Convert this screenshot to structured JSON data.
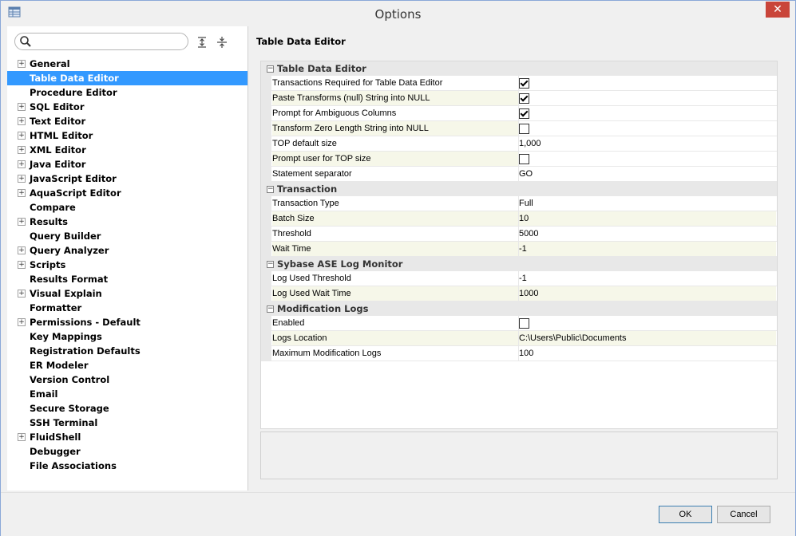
{
  "window": {
    "title": "Options",
    "close_label": "✕"
  },
  "search": {
    "placeholder": "",
    "value": ""
  },
  "tree": [
    {
      "label": "General",
      "expandable": true
    },
    {
      "label": "Table Data Editor",
      "expandable": false,
      "selected": true
    },
    {
      "label": "Procedure Editor",
      "expandable": false
    },
    {
      "label": "SQL Editor",
      "expandable": true
    },
    {
      "label": "Text Editor",
      "expandable": true
    },
    {
      "label": "HTML Editor",
      "expandable": true
    },
    {
      "label": "XML Editor",
      "expandable": true
    },
    {
      "label": "Java Editor",
      "expandable": true
    },
    {
      "label": "JavaScript Editor",
      "expandable": true
    },
    {
      "label": "AquaScript Editor",
      "expandable": true
    },
    {
      "label": "Compare",
      "expandable": false
    },
    {
      "label": "Results",
      "expandable": true
    },
    {
      "label": "Query Builder",
      "expandable": false
    },
    {
      "label": "Query Analyzer",
      "expandable": true
    },
    {
      "label": "Scripts",
      "expandable": true
    },
    {
      "label": "Results Format",
      "expandable": false
    },
    {
      "label": "Visual Explain",
      "expandable": true
    },
    {
      "label": "Formatter",
      "expandable": false
    },
    {
      "label": "Permissions - Default",
      "expandable": true
    },
    {
      "label": "Key Mappings",
      "expandable": false
    },
    {
      "label": "Registration Defaults",
      "expandable": false
    },
    {
      "label": "ER Modeler",
      "expandable": false
    },
    {
      "label": "Version Control",
      "expandable": false
    },
    {
      "label": "Email",
      "expandable": false
    },
    {
      "label": "Secure Storage",
      "expandable": false
    },
    {
      "label": "SSH Terminal",
      "expandable": false
    },
    {
      "label": "FluidShell",
      "expandable": true
    },
    {
      "label": "Debugger",
      "expandable": false
    },
    {
      "label": "File Associations",
      "expandable": false
    }
  ],
  "page_title": "Table Data Editor",
  "sections": [
    {
      "title": "Table Data Editor",
      "rows": [
        {
          "name": "Transactions Required for Table Data Editor",
          "type": "checkbox",
          "checked": true
        },
        {
          "name": "Paste Transforms (null) String into NULL",
          "type": "checkbox",
          "checked": true
        },
        {
          "name": "Prompt for Ambiguous Columns",
          "type": "checkbox",
          "checked": true
        },
        {
          "name": "Transform Zero Length String into NULL",
          "type": "checkbox",
          "checked": false
        },
        {
          "name": "TOP default size",
          "type": "text",
          "value": "1,000"
        },
        {
          "name": "Prompt user for TOP size",
          "type": "checkbox",
          "checked": false
        },
        {
          "name": "Statement separator",
          "type": "text",
          "value": "GO"
        }
      ]
    },
    {
      "title": "Transaction",
      "rows": [
        {
          "name": "Transaction Type",
          "type": "text",
          "value": "Full"
        },
        {
          "name": "Batch Size",
          "type": "text",
          "value": "10"
        },
        {
          "name": "Threshold",
          "type": "text",
          "value": "5000"
        },
        {
          "name": "Wait Time",
          "type": "text",
          "value": "-1"
        }
      ]
    },
    {
      "title": "Sybase ASE Log Monitor",
      "rows": [
        {
          "name": "Log Used Threshold",
          "type": "text",
          "value": "-1"
        },
        {
          "name": "Log Used Wait Time",
          "type": "text",
          "value": "1000"
        }
      ]
    },
    {
      "title": "Modification Logs",
      "rows": [
        {
          "name": "Enabled",
          "type": "checkbox",
          "checked": false
        },
        {
          "name": "Logs Location",
          "type": "text",
          "value": "C:\\Users\\Public\\Documents"
        },
        {
          "name": "Maximum Modification Logs",
          "type": "text",
          "value": "100"
        }
      ]
    }
  ],
  "buttons": {
    "ok": "OK",
    "cancel": "Cancel"
  }
}
